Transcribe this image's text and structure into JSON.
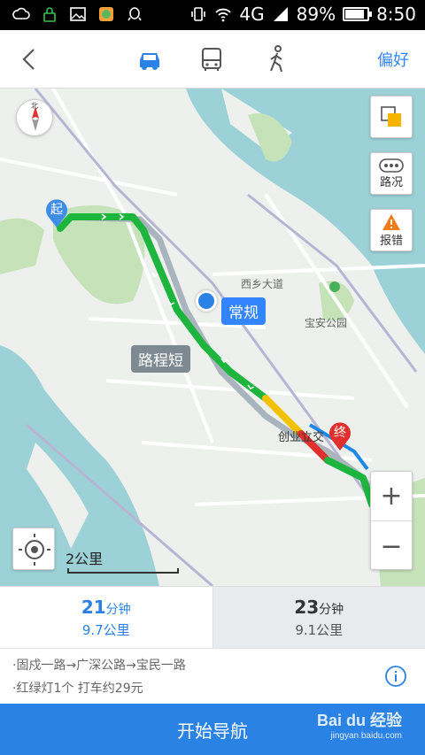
{
  "status_bar": {
    "network": "4G",
    "battery_percent": "89%",
    "battery_level": 0.89,
    "time": "8:50"
  },
  "toolbar": {
    "modes": [
      "car-icon",
      "bus-icon",
      "walk-icon"
    ],
    "active_mode": "car",
    "preference_label": "偏好"
  },
  "map": {
    "traffic_label": "路况",
    "report_label": "报错",
    "scale_label": "2公里",
    "tag_normal": "常规",
    "tag_short": "路程短",
    "start_label": "起",
    "end_label": "终",
    "road_xixiang": "西乡大道",
    "park_label": "宝安公园",
    "junction_label": "创业立交",
    "zoom_in": "+",
    "zoom_out": "−",
    "compass_label": "北"
  },
  "routes": [
    {
      "minutes": "21",
      "minutes_unit": "分钟",
      "distance": "9.7公里",
      "active": true
    },
    {
      "minutes": "23",
      "minutes_unit": "分钟",
      "distance": "9.1公里",
      "active": false
    }
  ],
  "details": {
    "path": "·固戍一路→广深公路→宝民一路",
    "info": "·红绿灯1个   打车约29元"
  },
  "start_nav_label": "开始导航",
  "watermark": {
    "brand": "Bai du 经验",
    "url": "jingyan.baidu.com"
  },
  "colors": {
    "accent": "#3385ff",
    "route_green": "#1db53e",
    "route_yellow": "#f2c200",
    "route_red": "#e0312e"
  }
}
